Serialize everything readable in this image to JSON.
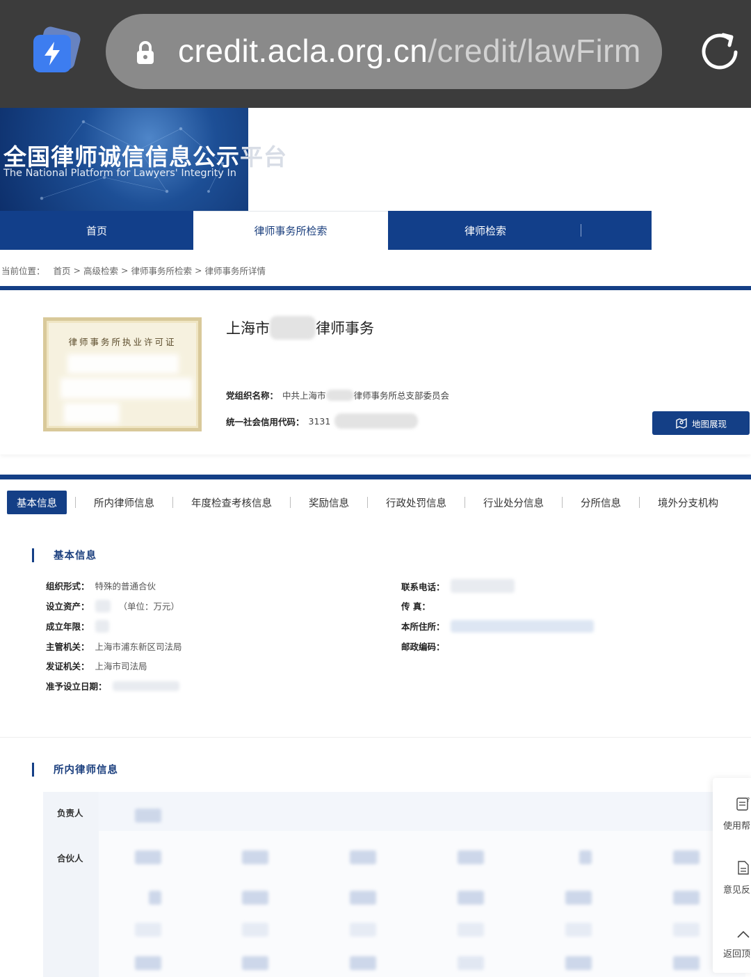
{
  "browser": {
    "url_host": "credit.acla.org.cn",
    "url_path": "/credit/lawFirm"
  },
  "banner": {
    "title_main": "全国律师诚信信息公示",
    "title_tail": "平台",
    "subtitle": "The National Platform for  Lawyers' Integrity In"
  },
  "nav": {
    "home": "首页",
    "firm_search": "律师事务所检索",
    "lawyer_search": "律师检索"
  },
  "breadcrumb": {
    "label": "当前位置：",
    "items": [
      "首页",
      ">",
      "高级检索",
      ">",
      "律师事务所检索",
      ">",
      "律师事务所详情"
    ]
  },
  "firm": {
    "license_title": "律师事务所执业许可证",
    "name_prefix": "上海市",
    "name_suffix": "律师事务",
    "party_label": "党组织名称：",
    "party_prefix": "中共上海市",
    "party_suffix": "律师事务所总支部委员会",
    "credit_label": "统一社会信用代码：",
    "credit_value": "3131",
    "map_button": "地图展现"
  },
  "tabs": [
    "基本信息",
    "所内律师信息",
    "年度检查考核信息",
    "奖励信息",
    "行政处罚信息",
    "行业处分信息",
    "分所信息",
    "境外分支机构"
  ],
  "basic": {
    "heading": "基本信息",
    "org_form_label": "组织形式：",
    "org_form_value": "特殊的普通合伙",
    "assets_label": "设立资产：",
    "assets_unit": "（单位：万元）",
    "years_label": "成立年限：",
    "authority_label": "主管机关：",
    "authority_value": "上海市浦东新区司法局",
    "issuer_label": "发证机关：",
    "issuer_value": "上海市司法局",
    "approval_date_label": "准予设立日期：",
    "phone_label": "联系电话：",
    "fax_label": "传 真：",
    "address_label": "本所住所：",
    "postcode_label": "邮政编码："
  },
  "lawyers": {
    "heading": "所内律师信息",
    "head_label": "负责人",
    "partners_label": "合伙人"
  },
  "side": {
    "help": "使用帮",
    "feedback": "意见反",
    "top": "返回顶"
  }
}
